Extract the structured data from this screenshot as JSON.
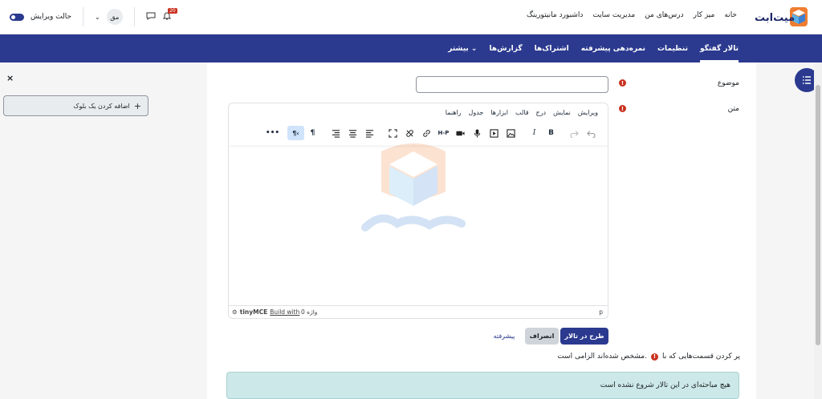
{
  "topnav": {
    "items": [
      "خانه",
      "میز کار",
      "درس‌های من",
      "مدیریت سایت",
      "داشبورد مانیتورینگ"
    ]
  },
  "user": {
    "avatar_text": "مق",
    "notification_count": "20",
    "edit_mode_label": "حالت ویرایش"
  },
  "secondary_nav": {
    "items": [
      "تالار گفتگو",
      "تنظیمات",
      "نمره‌دهی پیشرفته",
      "اشتراک‌ها",
      "گزارش‌ها",
      "بیشتر ⌄"
    ]
  },
  "drawer": {
    "close_symbol": "×",
    "add_block_label": "اضافه کردن یک بلوک",
    "add_symbol": "+"
  },
  "form": {
    "subject_label": "موضوع",
    "message_label": "متن",
    "required_symbol": "!"
  },
  "editor": {
    "menu": [
      "ویرایش",
      "نمایش",
      "درج",
      "قالب",
      "ابزارها",
      "جدول",
      "راهنما"
    ],
    "status_path": "p",
    "word_count": "0 واژه",
    "build_with": "Build with",
    "brand": "tinyMCE"
  },
  "buttons": {
    "post": "طرح در تالار",
    "cancel": "انصراف",
    "advanced": "پیشرفته"
  },
  "required_note": {
    "before": "پر کردن قسمت‌هایی که با",
    "after": "مشخص شده‌اند الزامی است."
  },
  "alert": {
    "text": "هیچ مباحثه‌ای در این تالار شروع نشده است"
  },
  "colors": {
    "brand": "#2b3a8f",
    "required": "#ca3120",
    "alert_bg": "#cde8e8"
  }
}
